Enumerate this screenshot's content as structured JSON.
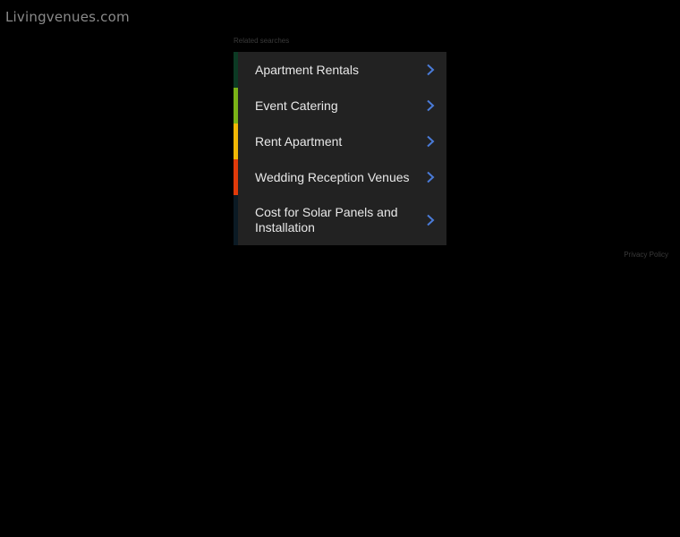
{
  "site": {
    "title": "Livingvenues.com"
  },
  "related": {
    "label": "Related searches",
    "items": [
      {
        "label": "Apartment Rentals",
        "accent": "#0c3a24",
        "icon": "chevron-right-icon"
      },
      {
        "label": "Event Catering",
        "accent": "#7ab317",
        "icon": "chevron-right-icon"
      },
      {
        "label": "Rent Apartment",
        "accent": "#f2b705",
        "icon": "chevron-right-icon"
      },
      {
        "label": "Wedding Reception Venues",
        "accent": "#e03a0a",
        "icon": "chevron-right-icon"
      },
      {
        "label": "Cost for Solar Panels and Installation",
        "accent": "#0b1a24",
        "icon": "chevron-right-icon"
      }
    ]
  },
  "footer": {
    "privacy_label": "Privacy Policy"
  },
  "colors": {
    "background": "#000000",
    "panel": "#222222",
    "chevron": "#4a7bd8"
  }
}
